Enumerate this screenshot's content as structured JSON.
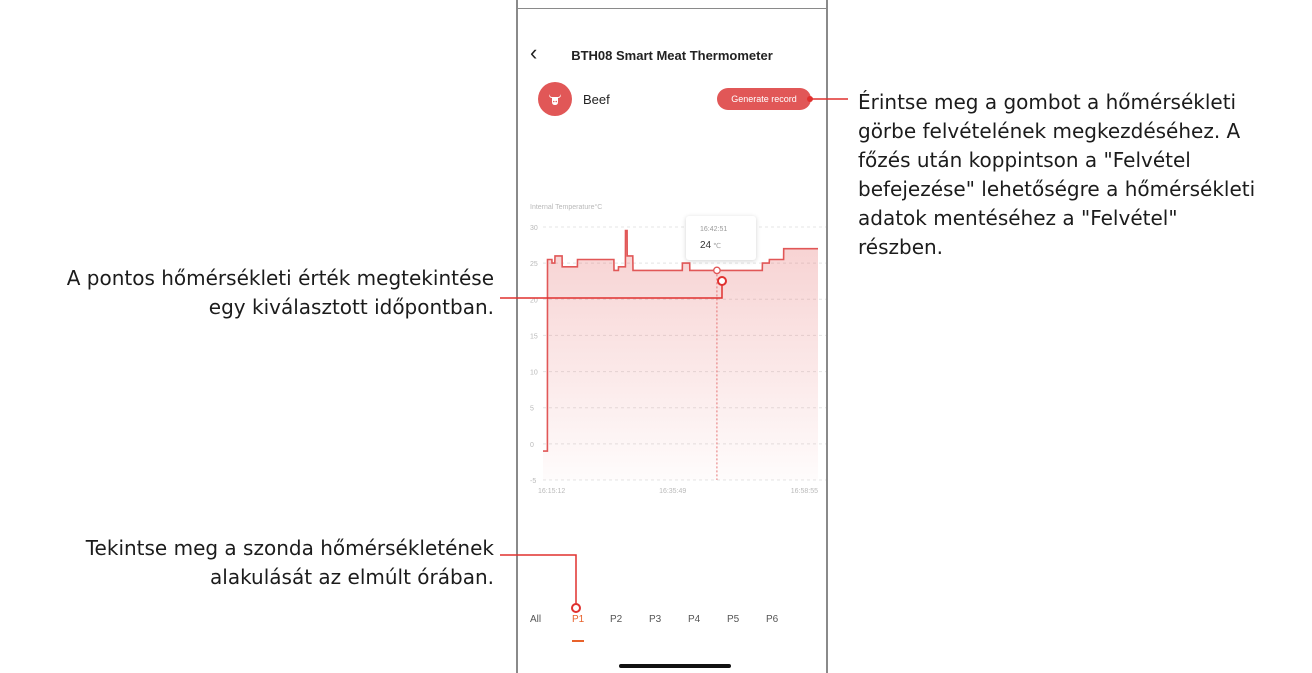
{
  "annotations": {
    "point_value": [
      "A pontos hőmérsékleti érték megtekintése",
      "egy kiválasztott időpontban."
    ],
    "probe_history": [
      "Tekintse meg a szonda hőmérsékletének",
      "alakulását az elmúlt órában."
    ],
    "generate_record": [
      "Érintse meg a gombot a hőmérsékleti",
      "görbe felvételének megkezdéséhez. A",
      "főzés után koppintson a \"Felvétel",
      "befejezése\" lehetőségre a hőmérsékleti",
      "adatok mentéséhez a \"Felvétel\"",
      "részben."
    ]
  },
  "app": {
    "back_icon": "chevron-left-icon",
    "back_glyph": "‹",
    "title": "BTH08 Smart Meat Thermometer",
    "meat_icon": "cow-head-icon",
    "meat_label": "Beef",
    "generate_button": "Generate record"
  },
  "colors": {
    "accent": "#e15757",
    "tab_active": "#e8622b",
    "annotation_line": "#e0312f"
  },
  "tooltip": {
    "time": "16:42:51",
    "value": "24",
    "unit": "℃"
  },
  "chart_data": {
    "type": "line",
    "ylabel": "Internal Temperature°C",
    "ylim": [
      -5,
      30
    ],
    "yticks": [
      -5,
      0,
      5,
      10,
      15,
      20,
      25,
      30
    ],
    "xticks": [
      "16:15:12",
      "16:35:49",
      "16:58:55"
    ],
    "x_start": "16:15:12",
    "x_end": "16:58:55",
    "grid": true,
    "area_fill": true,
    "selected_time": "16:42:51",
    "series": [
      {
        "x": [
          "16:15:12",
          "16:15:54",
          "16:15:55",
          "16:16:37",
          "16:16:38",
          "16:17:05",
          "16:17:06",
          "16:18:14",
          "16:18:15",
          "16:20:40",
          "16:20:41",
          "16:26:28",
          "16:26:29",
          "16:27:11",
          "16:27:12",
          "16:28:18",
          "16:28:19",
          "16:28:34",
          "16:28:35",
          "16:29:29",
          "16:29:30",
          "16:37:21",
          "16:37:22",
          "16:38:31",
          "16:38:32",
          "16:44:55",
          "16:44:56",
          "16:50:04",
          "16:50:05",
          "16:51:10",
          "16:51:11",
          "16:53:27",
          "16:53:28",
          "16:58:55"
        ],
        "y": [
          -1,
          -1,
          25.5,
          25.5,
          25,
          25,
          26,
          26,
          24.5,
          24.5,
          25.5,
          25.5,
          24,
          24,
          24.5,
          24.5,
          29.5,
          29.5,
          26,
          26,
          24,
          24,
          25,
          25,
          24,
          24,
          24,
          24,
          25,
          25,
          25.5,
          25.5,
          27,
          27
        ]
      }
    ]
  },
  "tabs": [
    "All",
    "P1",
    "P2",
    "P3",
    "P4",
    "P5",
    "P6"
  ],
  "active_tab": "P1"
}
